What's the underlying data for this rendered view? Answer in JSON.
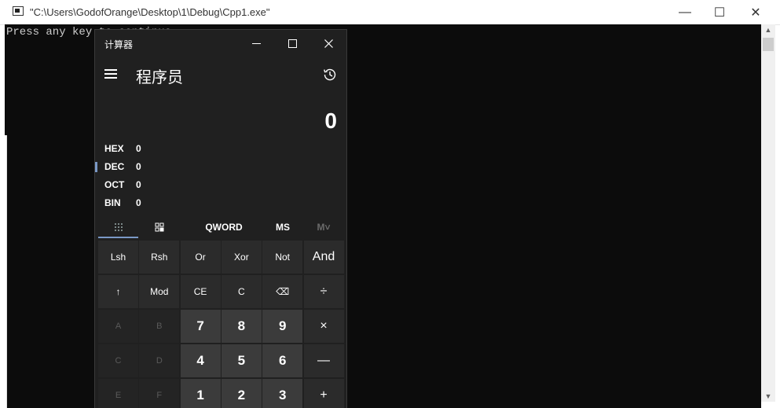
{
  "console": {
    "title": "\"C:\\Users\\GodofOrange\\Desktop\\1\\Debug\\Cpp1.exe\"",
    "output": "Press any key to continue",
    "minimize_glyph": "—",
    "maximize_glyph": "☐",
    "close_glyph": "✕"
  },
  "calculator": {
    "title": "计算器",
    "mode": "程序员",
    "display_value": "0",
    "radix": [
      {
        "label": "HEX",
        "value": "0"
      },
      {
        "label": "DEC",
        "value": "0"
      },
      {
        "label": "OCT",
        "value": "0"
      },
      {
        "label": "BIN",
        "value": "0"
      }
    ],
    "toolbar": {
      "word_size": "QWORD",
      "memory_store": "MS",
      "memory_list": "M˅"
    },
    "keys": [
      [
        "Lsh",
        "Rsh",
        "Or",
        "Xor",
        "Not",
        "And"
      ],
      [
        "↑",
        "Mod",
        "CE",
        "C",
        "⌫",
        "÷"
      ],
      [
        "A",
        "B",
        "7",
        "8",
        "9",
        "×"
      ],
      [
        "C",
        "D",
        "4",
        "5",
        "6",
        "—"
      ],
      [
        "E",
        "F",
        "1",
        "2",
        "3",
        "+"
      ]
    ]
  },
  "colors": {
    "accent": "#7a98c6",
    "calc_bg": "#202020",
    "console_bg": "#0c0c0c"
  }
}
